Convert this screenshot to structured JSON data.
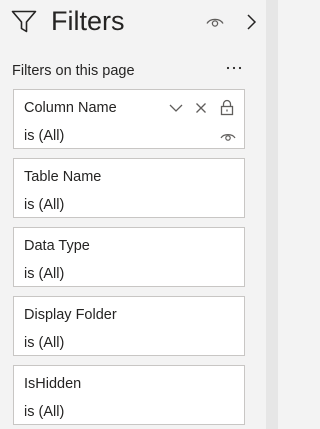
{
  "header": {
    "title": "Filters",
    "icons": [
      "filter-funnel-icon",
      "eye-icon",
      "chevron-right-icon"
    ]
  },
  "section": {
    "label": "Filters on this page",
    "more_icon": "more-ellipsis-icon"
  },
  "filters": [
    {
      "name": "Column Name",
      "value": "is (All)",
      "icons": [
        "chevron-down-icon",
        "clear-filter-icon",
        "lock-icon",
        "eye-icon"
      ]
    },
    {
      "name": "Table Name",
      "value": "is (All)"
    },
    {
      "name": "Data Type",
      "value": "is (All)"
    },
    {
      "name": "Display Folder",
      "value": "is (All)"
    },
    {
      "name": "IsHidden",
      "value": "is (All)"
    }
  ]
}
